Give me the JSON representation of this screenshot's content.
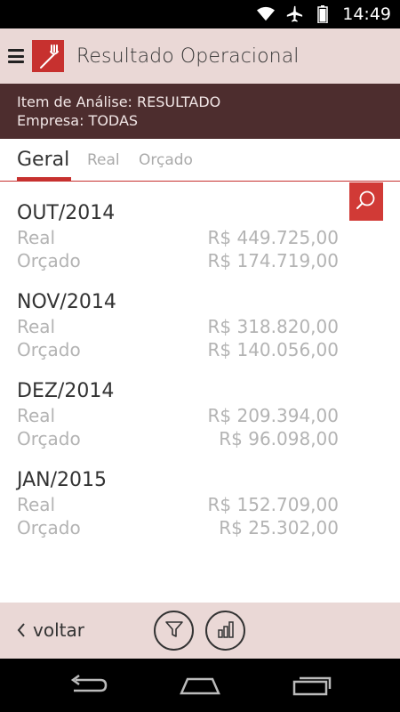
{
  "status_bar": {
    "time": "14:49",
    "icons": [
      "wifi-icon",
      "airplane-icon",
      "battery-icon"
    ]
  },
  "app_bar": {
    "menu_icon": "hamburger-icon",
    "logo_icon": "fork-icon",
    "title": "Resultado Operacional"
  },
  "info": {
    "line1": "Item de Análise: RESULTADO",
    "line2": "Empresa: TODAS"
  },
  "tabs": [
    {
      "label": "Geral",
      "active": true
    },
    {
      "label": "Real",
      "active": false
    },
    {
      "label": "Orçado",
      "active": false
    }
  ],
  "periods": [
    {
      "title": "OUT/2014",
      "rows": [
        {
          "label": "Real",
          "value": "R$ 449.725,00"
        },
        {
          "label": "Orçado",
          "value": "R$ 174.719,00"
        }
      ]
    },
    {
      "title": "NOV/2014",
      "rows": [
        {
          "label": "Real",
          "value": "R$ 318.820,00"
        },
        {
          "label": "Orçado",
          "value": "R$ 140.056,00"
        }
      ]
    },
    {
      "title": "DEZ/2014",
      "rows": [
        {
          "label": "Real",
          "value": "R$ 209.394,00"
        },
        {
          "label": "Orçado",
          "value": "R$ 96.098,00"
        }
      ]
    },
    {
      "title": "JAN/2015",
      "rows": [
        {
          "label": "Real",
          "value": "R$ 152.709,00"
        },
        {
          "label": "Orçado",
          "value": "R$ 25.302,00"
        }
      ]
    }
  ],
  "bottom_bar": {
    "back_label": "voltar",
    "filter_icon": "filter-icon",
    "chart_icon": "bar-chart-icon"
  },
  "colors": {
    "accent": "#c7312f",
    "appbar_bg": "#ead8d6",
    "info_bg": "#4d2d2e"
  }
}
